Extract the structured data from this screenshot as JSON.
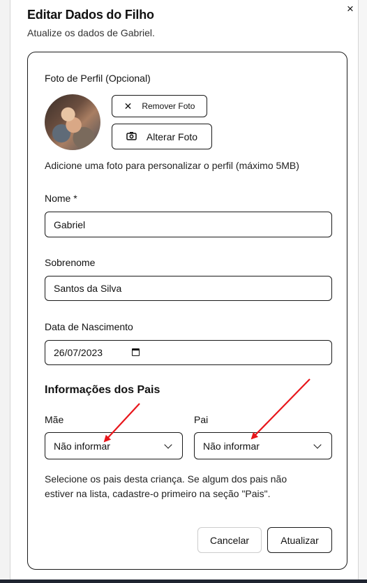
{
  "dialog": {
    "title": "Editar Dados do Filho",
    "subtitle": "Atualize os dados de Gabriel.",
    "close_icon": "×"
  },
  "photo": {
    "label": "Foto de Perfil (Opcional)",
    "remove_icon": "✕",
    "remove_label": "Remover Foto",
    "change_icon": "📷",
    "change_label": "Alterar Foto",
    "help": "Adicione uma foto para personalizar o perfil (máximo 5MB)"
  },
  "form": {
    "name_label": "Nome *",
    "name_value": "Gabriel",
    "surname_label": "Sobrenome",
    "surname_value": "Santos da Silva",
    "birth_label": "Data de Nascimento",
    "birth_value": "26/07/2023"
  },
  "parents": {
    "title": "Informações dos Pais",
    "mother_label": "Mãe",
    "mother_value": "Não informar",
    "father_label": "Pai",
    "father_value": "Não informar",
    "help_line1": "Selecione os pais desta criança. Se algum dos pais não",
    "help_line2": "estiver na lista, cadastre-o primeiro na seção \"Pais\"."
  },
  "actions": {
    "cancel_label": "Cancelar",
    "update_label": "Atualizar"
  },
  "colors": {
    "annotation_arrow": "#e8161b",
    "border": "#1a1a1a"
  }
}
